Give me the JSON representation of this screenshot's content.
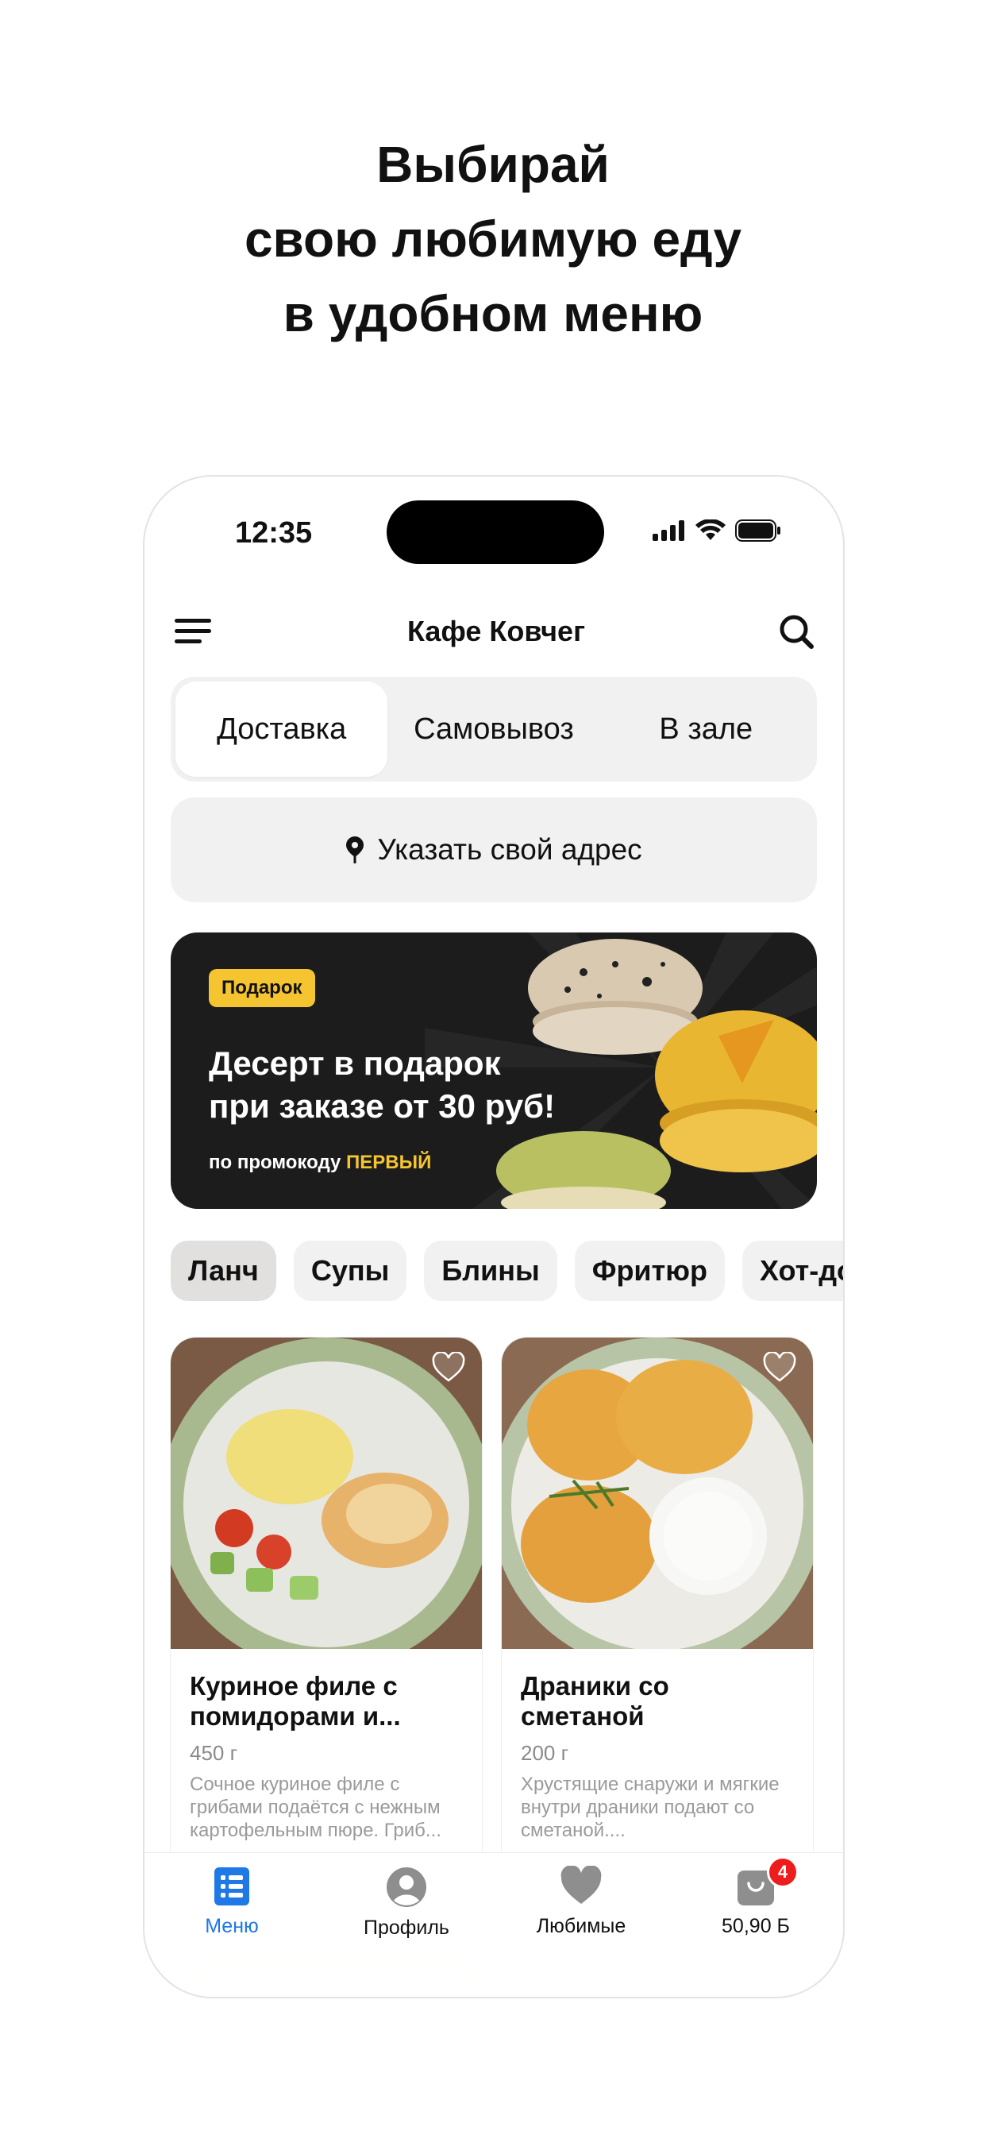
{
  "headline": [
    "Выбирай",
    "свою любимую еду",
    "в удобном меню"
  ],
  "status": {
    "time": "12:35"
  },
  "header": {
    "title": "Кафе Ковчег",
    "menu_icon": "hamburger-icon",
    "search_icon": "search-icon"
  },
  "delivery_modes": [
    {
      "label": "Доставка",
      "selected": true
    },
    {
      "label": "Самовывоз",
      "selected": false
    },
    {
      "label": "В зале",
      "selected": false
    }
  ],
  "address": {
    "icon": "location-pin-icon",
    "label": "Указать свой адрес"
  },
  "banner": {
    "badge": "Подарок",
    "title_line1": "Десерт в подарок",
    "title_line2": "при заказе от 30 руб!",
    "promo_prefix": "по промокоду",
    "promo_code": "ПЕРВЫЙ",
    "accent_color": "#f5c531"
  },
  "categories": [
    {
      "label": "Ланч",
      "selected": true
    },
    {
      "label": "Супы",
      "selected": false
    },
    {
      "label": "Блины",
      "selected": false
    },
    {
      "label": "Фритюр",
      "selected": false
    },
    {
      "label": "Хот-дог",
      "selected": false
    }
  ],
  "products": [
    {
      "name": "Куриное филе с помидорами и...",
      "weight": "450 г",
      "description": "Сочное куриное филе с грибами подаётся с нежным картофельным пюре. Гриб...",
      "favorite_icon": "heart-outline-icon"
    },
    {
      "name": "Драники со сметаной",
      "weight": "200 г",
      "description": "Хрустящие снаружи и мягкие внутри драники подают со сметаной....",
      "favorite_icon": "heart-outline-icon"
    }
  ],
  "tabbar": {
    "menu": "Меню",
    "profile": "Профиль",
    "favorites": "Любимые",
    "cart_total": "50,90 Б",
    "cart_count": "4",
    "active_color": "#1e78e6"
  }
}
